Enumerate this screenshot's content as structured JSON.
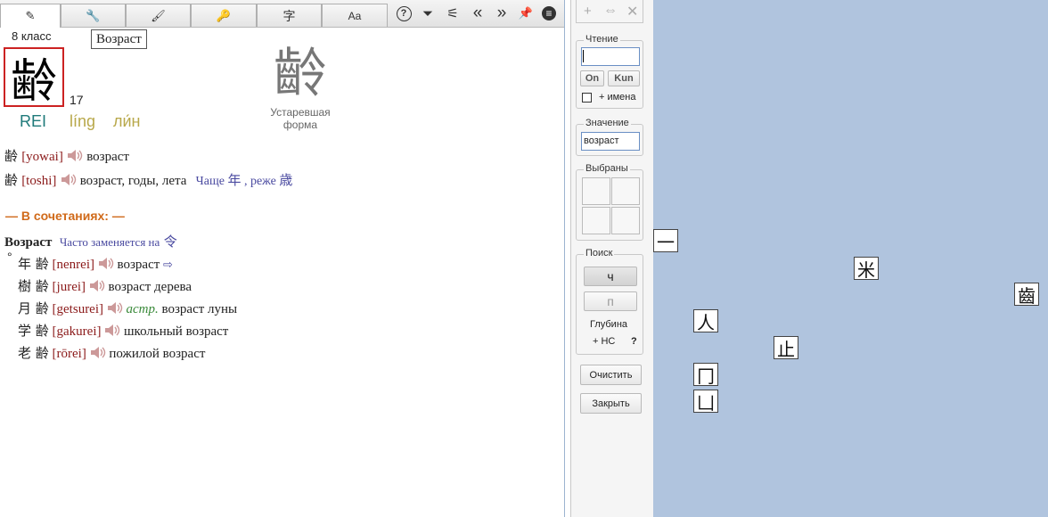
{
  "toolbar": {
    "tabs": [
      {
        "icon": "eraser-icon",
        "glyph": "✎"
      },
      {
        "icon": "wrench-icon",
        "glyph": "🔧"
      },
      {
        "icon": "brush-icon",
        "glyph": "🖌"
      },
      {
        "icon": "key-icon",
        "glyph": "🔑"
      },
      {
        "icon": "character-icon",
        "glyph": "字"
      },
      {
        "icon": "font-icon",
        "glyph": "Aa"
      }
    ],
    "tools": [
      {
        "icon": "help-icon",
        "glyph": "?"
      },
      {
        "icon": "filter-icon",
        "glyph": "⏷"
      },
      {
        "icon": "broom-icon",
        "glyph": "⚟"
      },
      {
        "icon": "back-icon",
        "glyph": "«"
      },
      {
        "icon": "forward-icon",
        "glyph": "»"
      },
      {
        "icon": "pin-icon",
        "glyph": "📌"
      },
      {
        "icon": "menu-icon",
        "glyph": "≡"
      }
    ]
  },
  "kanji": {
    "grade": "8 класс",
    "tooltip": "Возраст",
    "character": "齢",
    "strokes": "17",
    "on_romaji": "REI",
    "pinyin": "líng",
    "russian_reading": "ли́н",
    "old_form": "齡",
    "old_form_label_1": "Устаревшая",
    "old_form_label_2": "форма"
  },
  "readings": [
    {
      "kanji": "齢",
      "reading": "[yowai]",
      "meaning": "возраст",
      "note": ""
    },
    {
      "kanji": "齢",
      "reading": "[toshi]",
      "meaning": "возраст, годы, лета",
      "note_prefix": "Чаще",
      "note_k1": "年",
      "note_mid": ", реже",
      "note_k2": "歳"
    }
  ],
  "combinations": {
    "header": "— В сочетаниях: —",
    "group_title": "Возраст",
    "group_note": "Часто заменяется на",
    "group_note_kanji": "令",
    "items": [
      {
        "marker": "°",
        "word": "年 齢",
        "reading": "[nenrei]",
        "tag": "",
        "meaning": "возраст",
        "arrow": "⇨"
      },
      {
        "marker": "",
        "word": "樹 齢",
        "reading": "[jurei]",
        "tag": "",
        "meaning": "возраст дерева",
        "arrow": ""
      },
      {
        "marker": "",
        "word": "月 齢",
        "reading": "[getsurei]",
        "tag": "астр.",
        "meaning": "возраст луны",
        "arrow": ""
      },
      {
        "marker": "",
        "word": "学 齢",
        "reading": "[gakurei]",
        "tag": "",
        "meaning": "школьный возраст",
        "arrow": ""
      },
      {
        "marker": "",
        "word": "老 齢",
        "reading": "[rōrei]",
        "tag": "",
        "meaning": "пожилой возраст",
        "arrow": ""
      }
    ]
  },
  "search_panel": {
    "top_icons": [
      "+",
      "⇔",
      "✕"
    ],
    "reading_title": "Чтение",
    "reading_value": "",
    "on_button": "On",
    "kun_button": "Kun",
    "names_label": "+ имена",
    "meaning_title": "Значение",
    "meaning_value": "возраст",
    "selected_title": "Выбраны",
    "search_title": "Поиск",
    "search_btn_1": "ч",
    "search_btn_2": "п",
    "depth_label": "Глубина",
    "nc_label": "+ НС",
    "help_label": "?",
    "clear_button": "Очистить",
    "close_button": "Закрыть"
  },
  "radicals": [
    "一",
    "米",
    "齒",
    "人",
    "止",
    "冂",
    "凵"
  ],
  "colors": {
    "canvas": "#b0c4de",
    "kanji_frame": "#cc2222",
    "on_color": "#1f7a7a",
    "pinyin_color": "#b8a84a",
    "reading_color": "#8b1a1a",
    "combinations_header": "#d06a1a"
  }
}
